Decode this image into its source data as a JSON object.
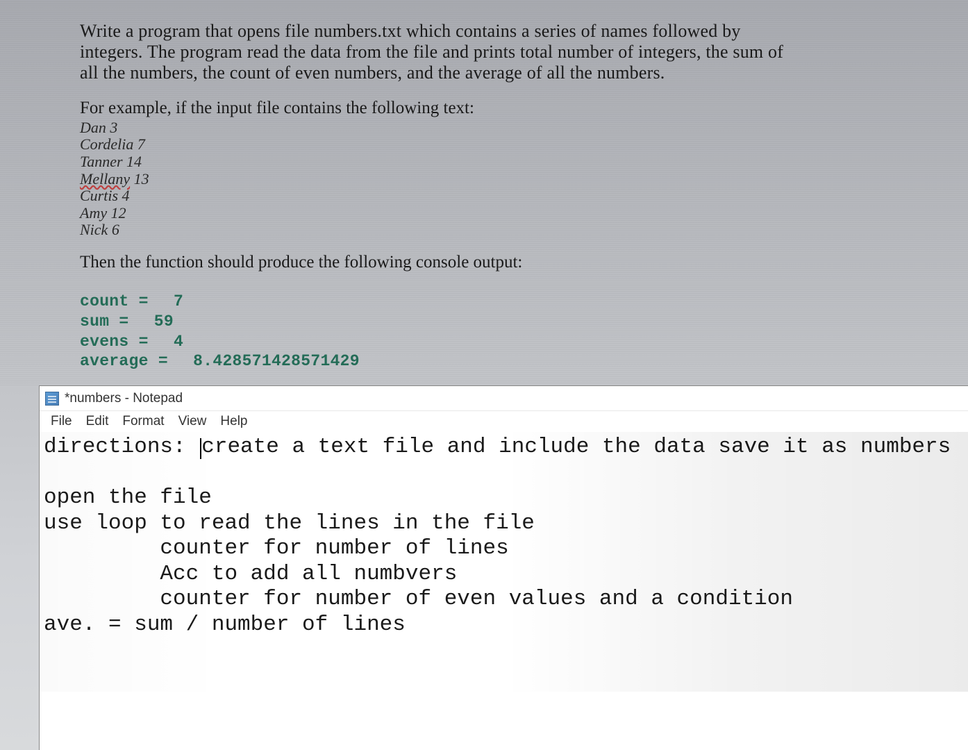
{
  "problem": {
    "description": "Write a program that opens file numbers.txt which contains a series of names followed by integers. The program read the data from the file and prints total number of integers, the sum of all the numbers, the count of even numbers, and the average of all the numbers.",
    "example_intro": "For example, if the input file contains the following text:",
    "input_data": [
      {
        "name": "Dan",
        "value": "3",
        "underline": false
      },
      {
        "name": "Cordelia",
        "value": "7",
        "underline": false
      },
      {
        "name": "Tanner",
        "value": "14",
        "underline": false
      },
      {
        "name": "Mellany",
        "value": "13",
        "underline": true
      },
      {
        "name": "Curtis",
        "value": "4",
        "underline": false
      },
      {
        "name": "Amy",
        "value": "12",
        "underline": false
      },
      {
        "name": "Nick",
        "value": "6",
        "underline": false
      }
    ],
    "output_intro": "Then the function should produce the following console output:",
    "console": [
      {
        "label": "count =",
        "value": "7"
      },
      {
        "label": "sum =",
        "value": "59"
      },
      {
        "label": "evens =",
        "value": "4"
      },
      {
        "label": "average =",
        "value": "8.428571428571429"
      }
    ]
  },
  "notepad": {
    "title": "*numbers - Notepad",
    "menu": [
      "File",
      "Edit",
      "Format",
      "View",
      "Help"
    ],
    "content": {
      "line1a": "directions: ",
      "line1b": "create a text file and include the data save it as numbers",
      "blank": "",
      "line2": "open the file",
      "line3": "use loop to read the lines in the file",
      "line4": "         counter for number of lines",
      "line5": "         Acc to add all numbvers",
      "line6": "         counter for number of even values and a condition",
      "line7": "ave. = sum / number of lines"
    }
  }
}
